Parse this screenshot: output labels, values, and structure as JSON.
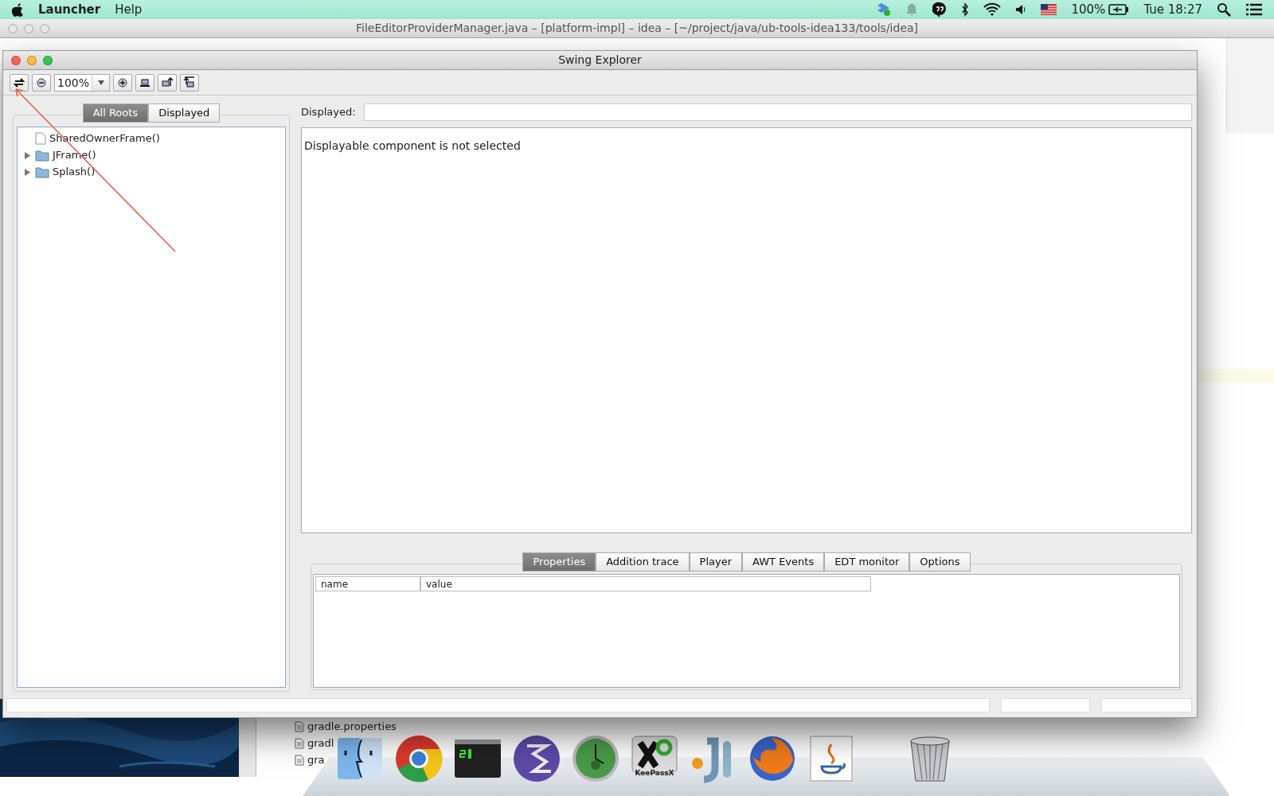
{
  "menubar": {
    "app": "Launcher",
    "menus": [
      "Help"
    ],
    "battery": "100%",
    "clock": "Tue 18:27"
  },
  "ide_window": {
    "title": "FileEditorProviderManager.java – [platform-impl] – idea – [~/project/java/ub-tools-idea133/tools/idea]",
    "files": [
      "gradle.properties",
      "gradl",
      "gra"
    ]
  },
  "swing_explorer": {
    "title": "Swing Explorer",
    "zoom": "100%",
    "tree_tabs": [
      {
        "label": "All Roots",
        "selected": true
      },
      {
        "label": "Displayed",
        "selected": false
      }
    ],
    "tree": [
      {
        "label": "SharedOwnerFrame()",
        "kind": "file"
      },
      {
        "label": "JFrame()",
        "kind": "folder",
        "expanded": false
      },
      {
        "label": "Splash()",
        "kind": "folder",
        "expanded": false
      }
    ],
    "displayed_label": "Displayed:",
    "message": "Displayable component is not selected",
    "bottom_tabs": [
      {
        "label": "Properties",
        "selected": true
      },
      {
        "label": "Addition trace",
        "selected": false
      },
      {
        "label": "Player",
        "selected": false
      },
      {
        "label": "AWT Events",
        "selected": false
      },
      {
        "label": "EDT monitor",
        "selected": false
      },
      {
        "label": "Options",
        "selected": false
      }
    ],
    "table": {
      "columns": [
        "name",
        "value"
      ]
    }
  },
  "dock": [
    {
      "kind": "finder"
    },
    {
      "kind": "chrome"
    },
    {
      "kind": "terminal"
    },
    {
      "kind": "emacs"
    },
    {
      "kind": "clock"
    },
    {
      "kind": "keepassx",
      "label": "KeePassX"
    },
    {
      "kind": "ji"
    },
    {
      "kind": "firefox"
    },
    {
      "kind": "java"
    },
    {
      "kind": "trash"
    }
  ]
}
